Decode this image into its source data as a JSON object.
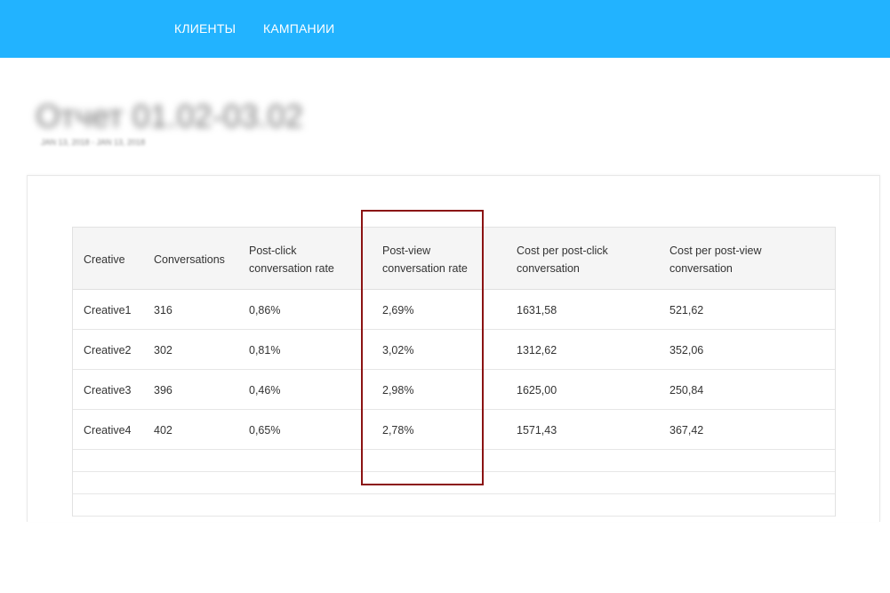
{
  "nav": {
    "clients": "КЛИЕНТЫ",
    "campaigns": "КАМПАНИИ"
  },
  "report": {
    "title": "Отчет 01.02-03.02",
    "dates": "JAN 13, 2018 - JAN 13, 2018"
  },
  "table": {
    "headers": [
      "Creative",
      "Conversations",
      "Post-click\nconversation rate",
      "Post-view\nconversation rate",
      "Cost per post-click\nconversation",
      "Cost per post-view\nconversation"
    ],
    "rows": [
      [
        "Creative1",
        "316",
        "0,86%",
        "2,69%",
        "1631,58",
        "521,62"
      ],
      [
        "Creative2",
        "302",
        "0,81%",
        "3,02%",
        "1312,62",
        "352,06"
      ],
      [
        "Creative3",
        "396",
        "0,46%",
        "2,98%",
        "1625,00",
        "250,84"
      ],
      [
        "Creative4",
        "402",
        "0,65%",
        "2,78%",
        "1571,43",
        "367,42"
      ]
    ]
  },
  "colors": {
    "topbar": "#22b3ff",
    "highlight": "#8b1313"
  }
}
